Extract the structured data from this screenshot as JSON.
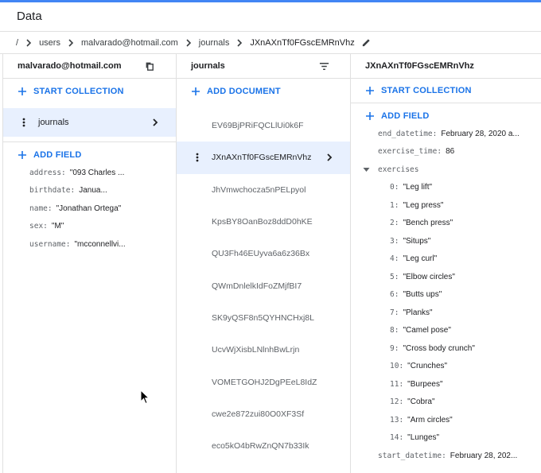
{
  "header": {
    "title": "Data"
  },
  "breadcrumb": {
    "items": [
      "/",
      "users",
      "malvarado@hotmail.com",
      "journals",
      "JXnAXnTf0FGscEMRnVhz"
    ]
  },
  "user_panel": {
    "title": "malvarado@hotmail.com",
    "start_collection": "START COLLECTION",
    "collection": "journals",
    "add_field": "ADD FIELD",
    "fields": [
      {
        "key": "address:",
        "value": "\"093 Charles ..."
      },
      {
        "key": "birthdate:",
        "value": "Janua..."
      },
      {
        "key": "name:",
        "value": "\"Jonathan Ortega\""
      },
      {
        "key": "sex:",
        "value": "\"M\""
      },
      {
        "key": "username:",
        "value": "\"mcconnellvi..."
      }
    ]
  },
  "journals_panel": {
    "title": "journals",
    "add_document": "ADD DOCUMENT",
    "documents": [
      "EV69BjPRiFQCLlUi0k6F",
      "JXnAXnTf0FGscEMRnVhz",
      "JhVmwchocza5nPELpyol",
      "KpsBY8OanBoz8ddD0hKE",
      "QU3Fh46EUyva6a6z36Bx",
      "QWmDnlelkIdFoZMjfBI7",
      "SK9yQSF8n5QYHNCHxj8L",
      "UcvWjXisbLNlnhBwLrjn",
      "VOMETGOHJ2DgPEeL8IdZ",
      "cwe2e872zui80O0XF3Sf",
      "eco5kO4bRwZnQN7b33Ik"
    ],
    "selected_index": 1
  },
  "doc_panel": {
    "title": "JXnAXnTf0FGscEMRnVhz",
    "start_collection": "START COLLECTION",
    "add_field": "ADD FIELD",
    "end_datetime": {
      "key": "end_datetime:",
      "value": "February 28, 2020 a..."
    },
    "exercise_time": {
      "key": "exercise_time:",
      "value": "86"
    },
    "exercises_key": "exercises",
    "exercises": [
      {
        "key": "0:",
        "value": "\"Leg lift\""
      },
      {
        "key": "1:",
        "value": "\"Leg press\""
      },
      {
        "key": "2:",
        "value": "\"Bench press\""
      },
      {
        "key": "3:",
        "value": "\"Situps\""
      },
      {
        "key": "4:",
        "value": "\"Leg curl\""
      },
      {
        "key": "5:",
        "value": "\"Elbow circles\""
      },
      {
        "key": "6:",
        "value": "\"Butts ups\""
      },
      {
        "key": "7:",
        "value": "\"Planks\""
      },
      {
        "key": "8:",
        "value": "\"Camel pose\""
      },
      {
        "key": "9:",
        "value": "\"Cross body crunch\""
      },
      {
        "key": "10:",
        "value": "\"Crunches\""
      },
      {
        "key": "11:",
        "value": "\"Burpees\""
      },
      {
        "key": "12:",
        "value": "\"Cobra\""
      },
      {
        "key": "13:",
        "value": "\"Arm circles\""
      },
      {
        "key": "14:",
        "value": "\"Lunges\""
      }
    ],
    "start_datetime": {
      "key": "start_datetime:",
      "value": "February 28, 202..."
    }
  },
  "colors": {
    "accent": "#1a73e8",
    "selected_bg": "#e8f0fe",
    "divider": "#e0e0e0"
  }
}
